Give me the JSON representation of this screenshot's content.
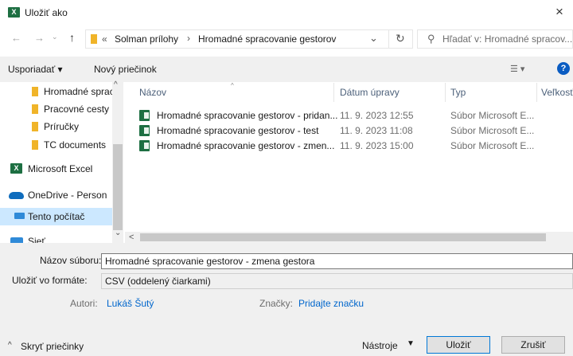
{
  "window": {
    "title": "Uložiť ako",
    "close_symbol": "×"
  },
  "address": {
    "segments": [
      "«",
      "Solman prílohy",
      "Hromadné spracovanie gestorov"
    ],
    "separator": "›"
  },
  "search": {
    "placeholder": "Hľadať v: Hromadné spracov..."
  },
  "toolbar": {
    "organize": "Usporiadať ▾",
    "new_folder": "Nový priečinok"
  },
  "sidebar": {
    "items": [
      {
        "label": "Hromadné sprac",
        "icon": "folder-icon"
      },
      {
        "label": "Pracovné cesty",
        "icon": "folder-icon"
      },
      {
        "label": "Príručky",
        "icon": "folder-icon"
      },
      {
        "label": "TC documents",
        "icon": "folder-icon"
      },
      {
        "label": "Microsoft Excel",
        "icon": "excel-icon"
      },
      {
        "label": "OneDrive - Person",
        "icon": "onedrive-icon"
      },
      {
        "label": "Tento počítač",
        "icon": "computer-icon"
      },
      {
        "label": "Sieť",
        "icon": "network-icon"
      }
    ]
  },
  "columns": {
    "name": "Názov",
    "date": "Dátum úpravy",
    "type": "Typ",
    "size": "Veľkosť"
  },
  "files": [
    {
      "name": "Hromadné spracovanie gestorov - pridan...",
      "date": "11. 9. 2023 12:55",
      "type": "Súbor Microsoft E..."
    },
    {
      "name": "Hromadné spracovanie gestorov - test",
      "date": "11. 9. 2023 11:08",
      "type": "Súbor Microsoft E..."
    },
    {
      "name": "Hromadné spracovanie gestorov - zmen...",
      "date": "11. 9. 2023 15:00",
      "type": "Súbor Microsoft E..."
    }
  ],
  "form": {
    "filename_label": "Názov súboru:",
    "filename_value": "Hromadné spracovanie gestorov - zmena gestora",
    "format_label": "Uložiť vo formáte:",
    "format_value": "CSV (oddelený čiarkami)",
    "authors_label": "Autori:",
    "authors_value": "Lukáš Šutý",
    "tags_label": "Značky:",
    "tags_value": "Pridajte značku"
  },
  "footer": {
    "hide_folders": "Skryť priečinky",
    "tools": "Nástroje",
    "save": "Uložiť",
    "cancel": "Zrušiť"
  },
  "colors": {
    "accent": "#0066cc",
    "excel": "#1d6f42",
    "folder": "#f0b429",
    "selected": "#cce8ff"
  }
}
